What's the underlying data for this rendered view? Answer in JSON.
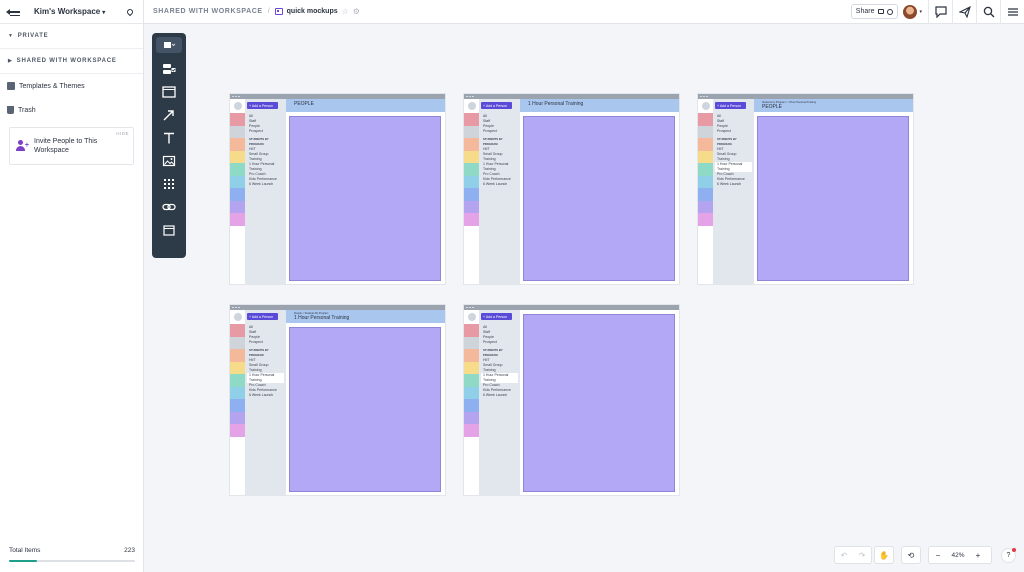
{
  "sidebar": {
    "workspace_name": "Kim's Workspace",
    "sections": [
      "PRIVATE",
      "SHARED WITH WORKSPACE"
    ],
    "items": [
      {
        "label": "Templates & Themes",
        "icon": "templates-icon"
      },
      {
        "label": "Trash",
        "icon": "trash-icon"
      }
    ],
    "invite": {
      "label": "Invite People to This Workspace",
      "hide": "HIDE"
    },
    "footer": {
      "label": "Total Items",
      "count": "223",
      "progress": 0.22
    }
  },
  "topbar": {
    "breadcrumb_parent": "SHARED WITH WORKSPACE",
    "board_name": "quick mockups",
    "share_label": "Share"
  },
  "toolbar": {
    "tools": [
      "board-dropdown-icon",
      "task-icon",
      "device-frame-icon",
      "arrow-icon",
      "text-icon",
      "image-icon",
      "grid-icon",
      "link-icon",
      "column-icon"
    ]
  },
  "mockups": {
    "add_person": "+ Add a Person",
    "nav_items": [
      "All",
      "Staff",
      "People",
      "Prospect"
    ],
    "nav_heading": "STUDENTS BY PROGRAM",
    "programs": [
      "HIIT",
      "Small Group",
      "Training",
      "1 Hour Personal",
      "Training",
      "Pro Coach",
      "Kids Performance",
      "6 Week Launch"
    ],
    "swatch_colors": [
      "#e89aa4",
      "#cfd3da",
      "#f3b99a",
      "#f6db8a",
      "#8fd9c7",
      "#8fd0e8",
      "#8fb0f0",
      "#b4a3ee",
      "#e4a3e6"
    ],
    "frames": [
      {
        "header": "PEOPLE",
        "subheader": "",
        "selected": -1
      },
      {
        "header": "1 Hour Personal Training",
        "subheader": "",
        "selected": -1
      },
      {
        "header": "PEOPLE",
        "subheader": "Students by Program > 1 Hour Personal Training",
        "selected": 3
      },
      {
        "header": "1 Hour Personal Training",
        "subheader": "People > Students By Program",
        "selected": 3
      },
      {
        "header": "",
        "subheader": "",
        "selected": 3
      }
    ]
  },
  "controls": {
    "zoom": "42%",
    "zoom_out": "−",
    "zoom_in": "+",
    "help": "?"
  }
}
